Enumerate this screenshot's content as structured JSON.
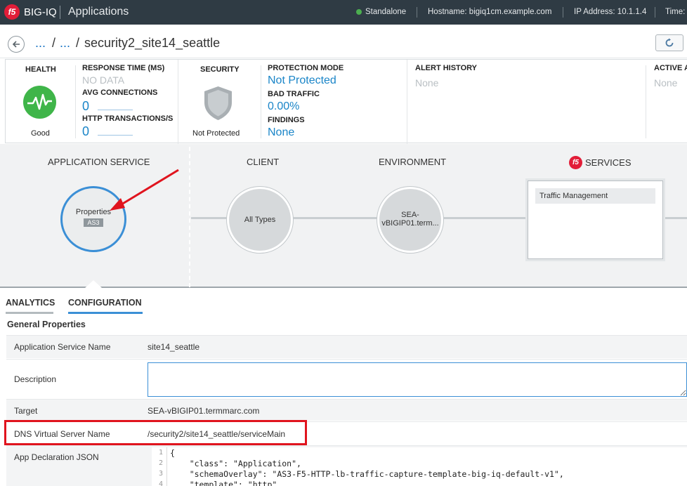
{
  "topbar": {
    "logo": "f5",
    "brand": "BIG-IQ",
    "app": "Applications",
    "mode": "Standalone",
    "hostname": "Hostname: bigiq1cm.example.com",
    "ip": "IP Address: 10.1.1.4",
    "time": "Time:"
  },
  "breadcrumb": {
    "back_icon": "arrow-left-icon",
    "items": [
      "...",
      "..."
    ],
    "current": "security2_site14_seattle",
    "refresh_icon": "refresh-icon"
  },
  "metrics": {
    "health": {
      "label": "HEALTH",
      "status": "Good",
      "icon": "heartbeat-icon"
    },
    "response_time": {
      "label": "RESPONSE TIME (MS)",
      "value": "NO DATA"
    },
    "avg_connections": {
      "label": "AVG CONNECTIONS",
      "value": "0"
    },
    "http_transactions": {
      "label": "HTTP TRANSACTIONS/S",
      "value": "0"
    },
    "security": {
      "label": "SECURITY",
      "status": "Not Protected",
      "icon": "shield-icon"
    },
    "protection_mode": {
      "label": "PROTECTION MODE",
      "value": "Not Protected"
    },
    "bad_traffic": {
      "label": "BAD TRAFFIC",
      "value": "0.00%"
    },
    "findings": {
      "label": "FINDINGS",
      "value": "None"
    },
    "alert_history": {
      "label": "ALERT HISTORY",
      "value": "None"
    },
    "active_alerts": {
      "label": "ACTIVE A",
      "value": "None"
    }
  },
  "topology": {
    "app_service": {
      "title": "APPLICATION SERVICE",
      "node_label": "Properties",
      "tag": "AS3"
    },
    "client": {
      "title": "CLIENT",
      "node_label": "All Types"
    },
    "environment": {
      "title": "ENVIRONMENT",
      "node_line1": "SEA-",
      "node_line2": "vBIGIP01.term..."
    },
    "services": {
      "title": "SERVICES",
      "item": "Traffic Management"
    }
  },
  "tabs": [
    {
      "label": "ANALYTICS",
      "active": false
    },
    {
      "label": "CONFIGURATION",
      "active": true
    }
  ],
  "section_title": "General Properties",
  "properties": {
    "app_service_name": {
      "label": "Application Service Name",
      "value": "site14_seattle"
    },
    "description": {
      "label": "Description",
      "value": ""
    },
    "target": {
      "label": "Target",
      "value": "SEA-vBIGIP01.termmarc.com"
    },
    "dns_vs_name": {
      "label": "DNS Virtual Server Name",
      "value": "/security2/site14_seattle/serviceMain"
    },
    "app_decl_json": {
      "label": "App Declaration JSON"
    }
  },
  "code": {
    "line_numbers": [
      "1",
      "2",
      "3",
      "4"
    ],
    "lines": [
      "{",
      "    \"class\": \"Application\",",
      "    \"schemaOverlay\": \"AS3-F5-HTTP-lb-traffic-capture-template-big-iq-default-v1\",",
      "    \"template\": \"http\","
    ]
  },
  "colors": {
    "topbar_bg": "#2f3b44",
    "accent_blue": "#1a85c8",
    "health_green": "#3fb549",
    "highlight_red": "#e0141e",
    "f5_red": "#e21d38"
  }
}
